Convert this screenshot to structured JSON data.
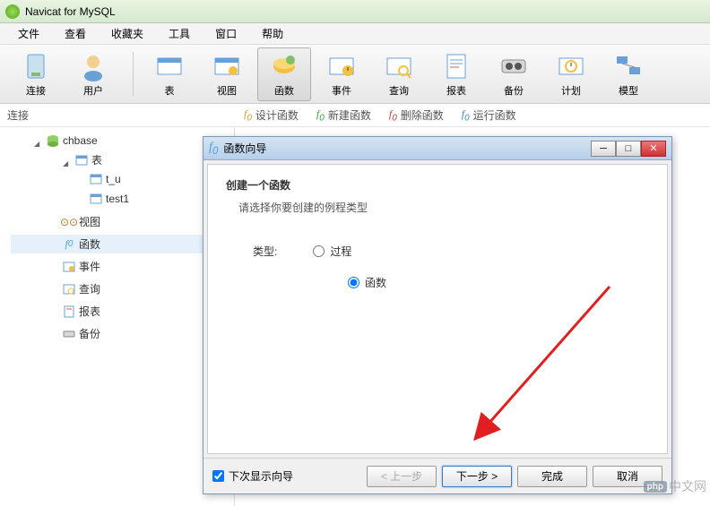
{
  "app": {
    "title": "Navicat for MySQL"
  },
  "menu": {
    "file": "文件",
    "view": "查看",
    "favorite": "收藏夹",
    "tools": "工具",
    "window": "窗口",
    "help": "帮助"
  },
  "toolbar": {
    "connection": "连接",
    "user": "用户",
    "table": "表",
    "view": "视图",
    "function": "函数",
    "event": "事件",
    "query": "查询",
    "report": "报表",
    "backup": "备份",
    "schedule": "计划",
    "model": "模型"
  },
  "subtoolbar": {
    "left": "连接",
    "design": "设计函数",
    "new": "新建函数",
    "delete": "删除函数",
    "run": "运行函数"
  },
  "tree": {
    "db": "chbase",
    "tables_group": "表",
    "tables": [
      "t_u",
      "test1"
    ],
    "views": "视图",
    "functions": "函数",
    "events": "事件",
    "queries": "查询",
    "reports": "报表",
    "backups": "备份"
  },
  "dialog": {
    "title": "函数向导",
    "heading": "创建一个函数",
    "hint": "请选择你要创建的例程类型",
    "type_label": "类型:",
    "opt_proc": "过程",
    "opt_func": "函数",
    "selected": "function",
    "show_next_time": "下次显示向导",
    "show_next_time_checked": true,
    "btn_prev": "< 上一步",
    "btn_next": "下一步 >",
    "btn_finish": "完成",
    "btn_cancel": "取消"
  },
  "watermark": {
    "badge": "php",
    "text": "中文网"
  }
}
